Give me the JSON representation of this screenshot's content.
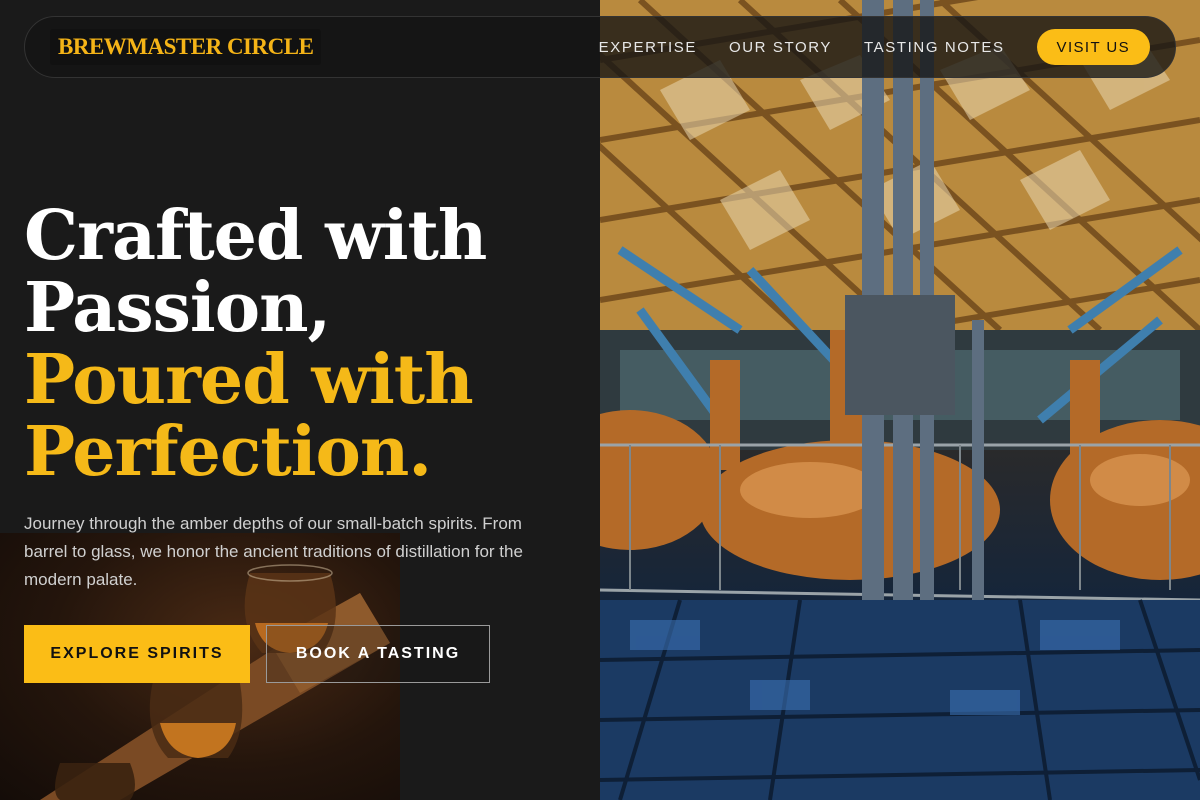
{
  "brand": {
    "name": "BREWMASTER CIRCLE"
  },
  "nav": {
    "links": [
      "EXPERTISE",
      "OUR STORY",
      "TASTING NOTES"
    ],
    "cta_label": "VISIT US"
  },
  "hero": {
    "headline_white": [
      "Crafted with",
      "Passion,"
    ],
    "headline_gold": [
      "Poured with",
      "Perfection."
    ],
    "lede": "Journey through the amber depths of our small-batch spirits. From barrel to glass, we honor the ancient traditions of distillation for the modern palate.",
    "primary_cta": "EXPLORE SPIRITS",
    "secondary_cta": "BOOK A TASTING"
  },
  "colors": {
    "accent": "#fbbd16",
    "background": "#1a1a1a",
    "text": "#ffffff"
  },
  "images": {
    "hero_photo": "distillery copper pot stills under a timber lattice roof",
    "flight_photo": "whisky tasting flight of glasses on a wooden paddle"
  }
}
